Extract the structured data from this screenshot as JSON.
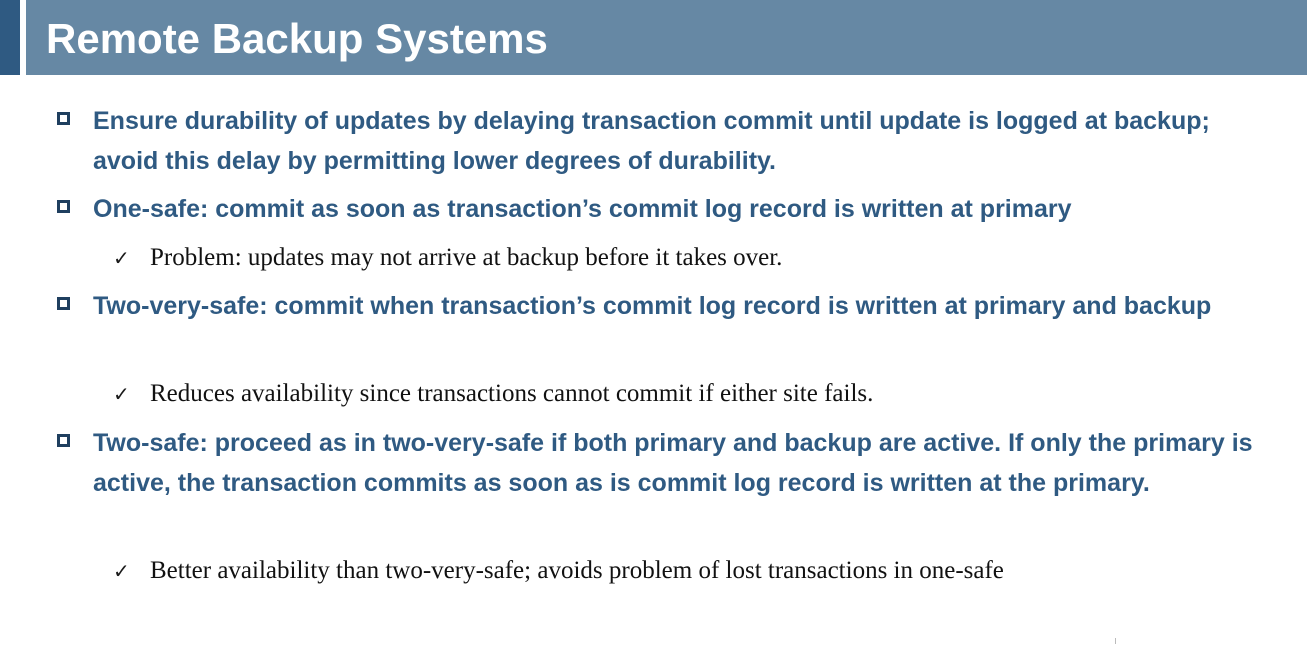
{
  "slide": {
    "title": "Remote Backup Systems",
    "bullets": [
      {
        "text": "Ensure durability of updates by delaying transaction commit until update is logged at backup; avoid this delay by permitting lower degrees of durability.",
        "subitems": []
      },
      {
        "text": "One-safe: commit as soon as transaction’s commit log record is written at primary",
        "subitems": [
          "Problem: updates may not arrive at backup before it takes over."
        ]
      },
      {
        "text": "Two-very-safe: commit when transaction’s commit log record is written at primary and backup",
        "subitems": [
          "Reduces availability since transactions cannot commit if either site fails."
        ]
      },
      {
        "text": "Two-safe: proceed as in two-very-safe if both primary and backup are active. If only the primary is active, the transaction commits as soon as is commit log record is written at the primary.",
        "subitems": [
          "Better availability than two-very-safe; avoids problem of lost transactions in one-safe"
        ]
      }
    ]
  },
  "theme": {
    "title_bar_color": "#6688a4",
    "accent_color": "#2f5a82",
    "bullet_text_color": "#2f5a82",
    "bullet_icon": "hollow-square-bullet-icon",
    "sub_bullet_icon": "checkmark-icon"
  }
}
